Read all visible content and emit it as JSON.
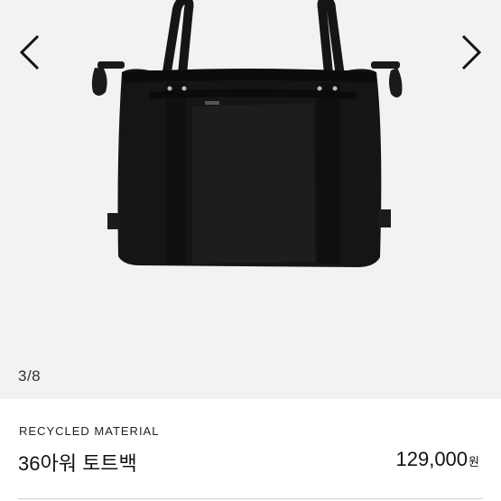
{
  "gallery": {
    "prev_icon": "chevron-left-icon",
    "next_icon": "chevron-right-icon",
    "counter": "3/8",
    "background_color": "#f2f2f2",
    "bag_color": "#151515"
  },
  "product": {
    "collection": "RECYCLED MATERIAL",
    "name": "36아워 토트백",
    "price": "129,000",
    "price_unit": "원"
  }
}
